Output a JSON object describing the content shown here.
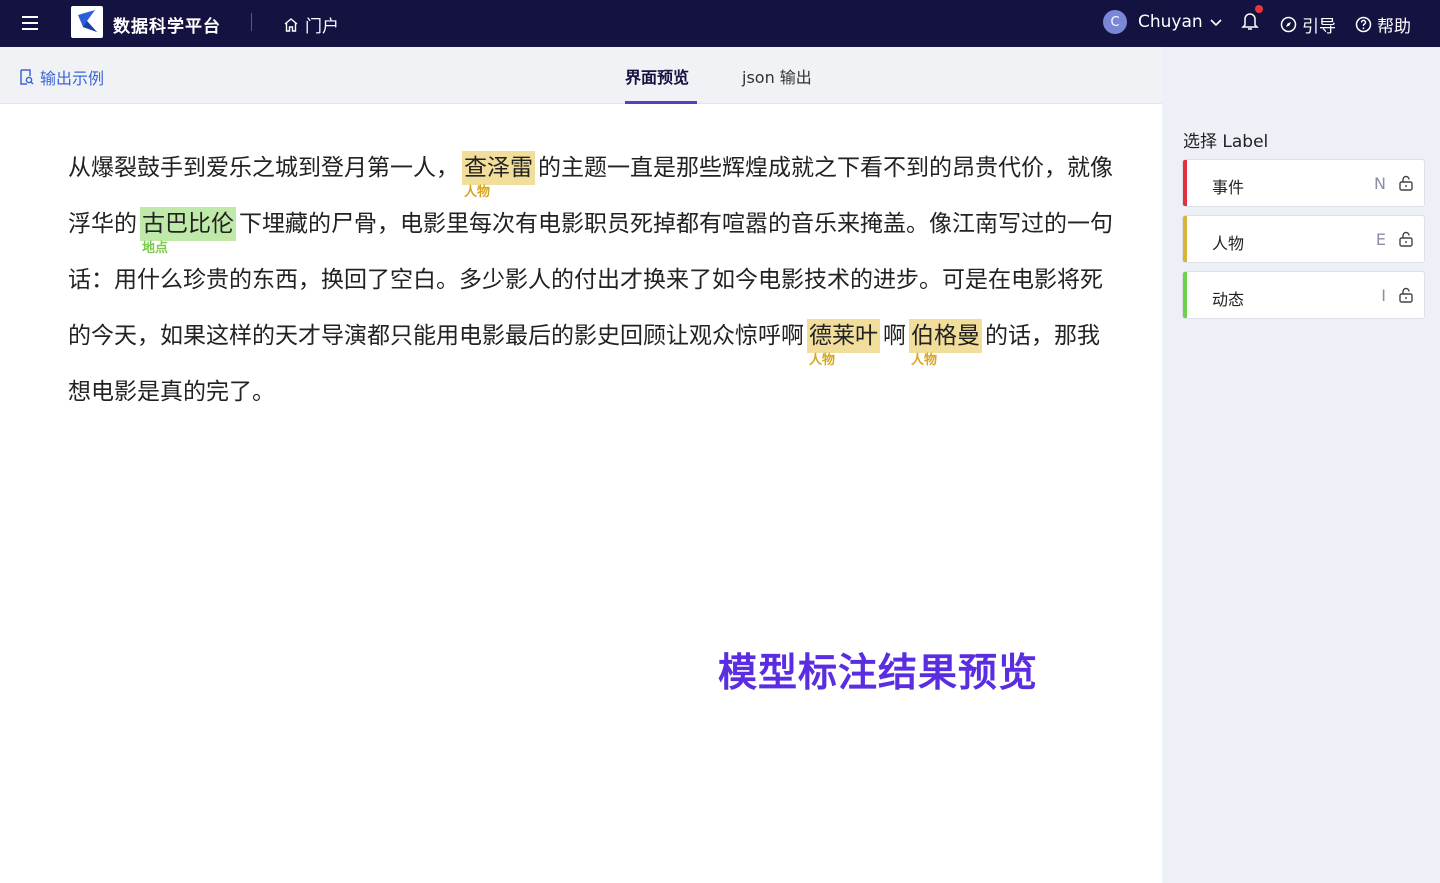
{
  "topbar": {
    "brand": "数据科学平台",
    "portal_label": "门户",
    "user_initial": "C",
    "user_name": "Chuyan",
    "guide_label": "引导",
    "help_label": "帮助"
  },
  "subbar": {
    "example_label": "输出示例",
    "tabs": [
      {
        "label": "界面预览",
        "active": true
      },
      {
        "label": "json 输出",
        "active": false
      }
    ]
  },
  "right_panel": {
    "title": "选择 Label",
    "labels": [
      {
        "name": "事件",
        "key": "N",
        "color": "#e0323c"
      },
      {
        "name": "人物",
        "key": "E",
        "color": "#d9b43b"
      },
      {
        "name": "动态",
        "key": "I",
        "color": "#6dd24b"
      }
    ]
  },
  "document": {
    "segments": [
      {
        "text": "从爆裂鼓手到爱乐之城到登月第一人，"
      },
      {
        "text": "查泽雷",
        "entity": "人物",
        "kind": "person"
      },
      {
        "text": "的主题一直是那些辉煌成就之下看不到的昂贵代价，就像浮华的"
      },
      {
        "text": "古巴比伦",
        "entity": "地点",
        "kind": "place"
      },
      {
        "text": "下埋藏的尸骨，电影里每次有电影职员死掉都有喧嚣的音乐来掩盖。像江南写过的一句话：用什么珍贵的东西，换回了空白。多少影人的付出才换来了如今电影技术的进步。可是在电影将死的今天，如果这样的天才导演都只能用电影最后的影史回顾让观众惊呼啊"
      },
      {
        "text": "德莱叶",
        "entity": "人物",
        "kind": "person"
      },
      {
        "text": "啊"
      },
      {
        "text": "伯格曼",
        "entity": "人物",
        "kind": "person"
      },
      {
        "text": "的话，那我想电影是真的完了。"
      }
    ]
  },
  "watermark": "模型标注结果预览"
}
